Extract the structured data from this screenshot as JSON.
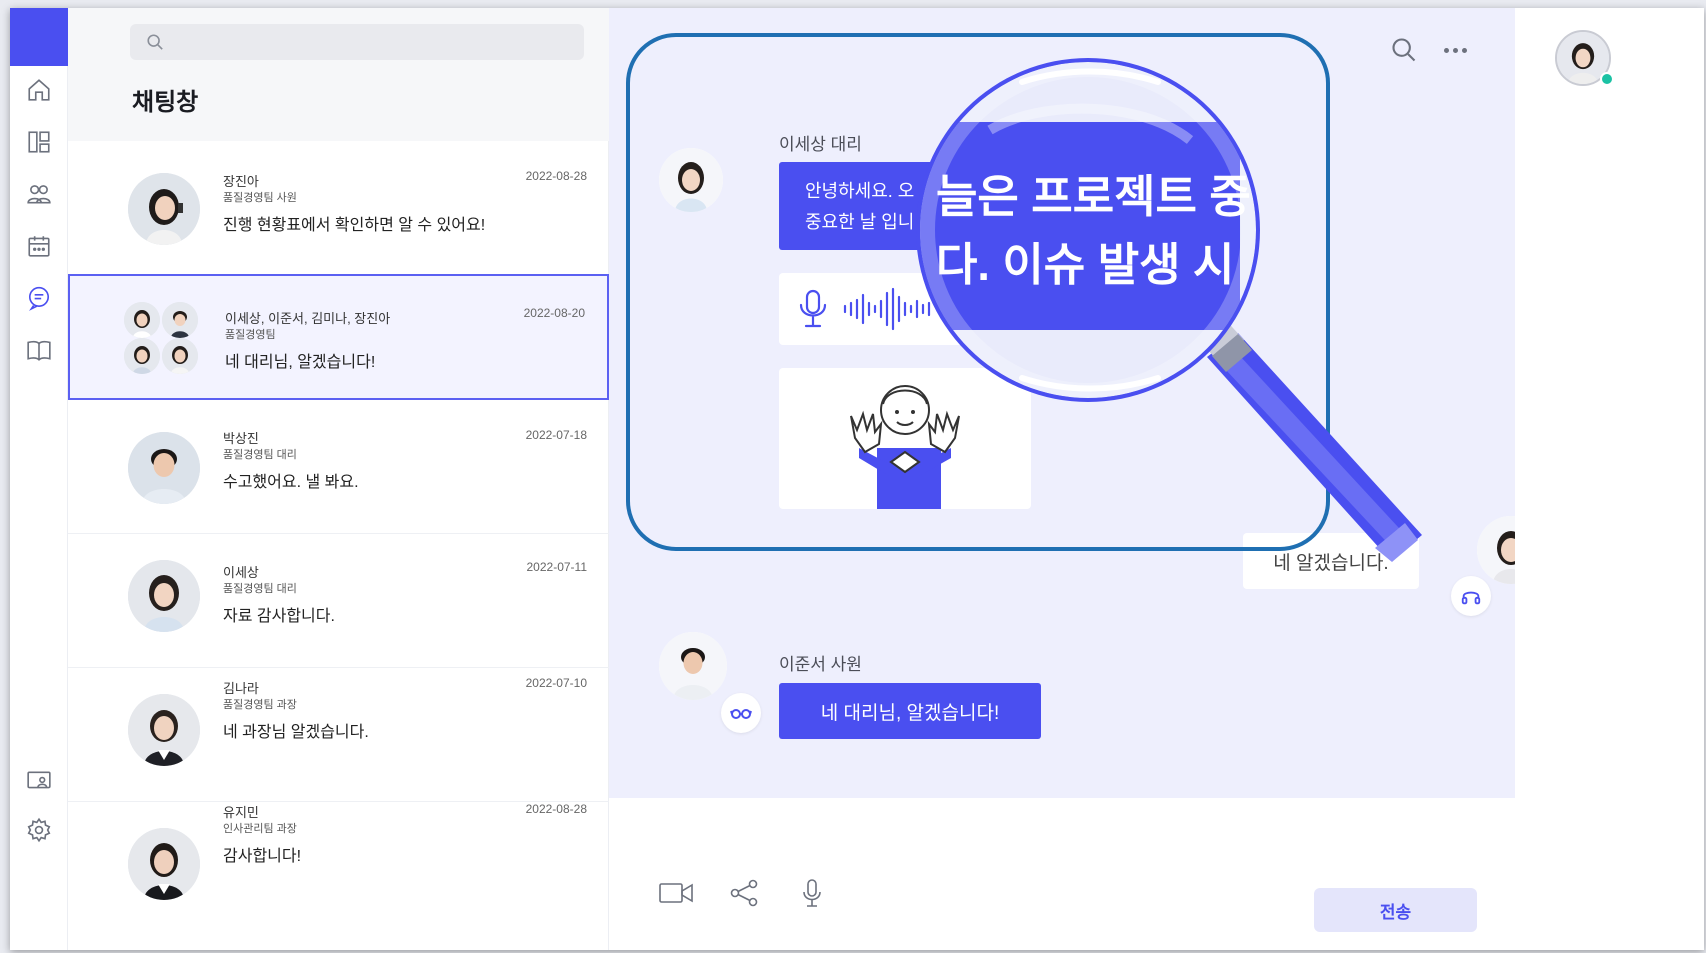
{
  "list": {
    "search_placeholder": "",
    "title": "채팅창",
    "items": [
      {
        "name": "장진아",
        "dept": "품질경영팀 사원",
        "message": "진행 현황표에서 확인하면 알 수 있어요!",
        "date": "2022-08-28"
      },
      {
        "name": "이세상, 이준서, 김미나, 장진아",
        "dept": "품질경영팀",
        "message": "네 대리님, 알겠습니다!",
        "date": "2022-08-20"
      },
      {
        "name": "박상진",
        "dept": "품질경영팀 대리",
        "message": "수고했어요. 낼 봐요.",
        "date": "2022-07-18"
      },
      {
        "name": "이세상",
        "dept": "품질경영팀 대리",
        "message": "자료 감사합니다.",
        "date": "2022-07-11"
      },
      {
        "name": "김나라",
        "dept": "품질경영팀 과장",
        "message": "네 과장님 알겠습니다.",
        "date": "2022-07-10"
      },
      {
        "name": "유지민",
        "dept": "인사관리팀 과장",
        "message": "감사합니다!",
        "date": "2022-08-28"
      }
    ]
  },
  "chat": {
    "msg1": {
      "sender": "이세상 대리",
      "line1": "안녕하세요. 오",
      "line2": "중요한 날 입니"
    },
    "magnified": {
      "line1": "늘은 프로젝트 중",
      "line2": "다. 이슈 발생 시"
    },
    "reply": "네 알겠습니다.",
    "msg2": {
      "sender": "이준서 사원",
      "text": "네 대리님, 알겠습니다!"
    },
    "send_label": "전송"
  },
  "colors": {
    "accent": "#4a4ff0",
    "chat_bg": "#eeeffd",
    "online": "#1bc2a4",
    "highlight_frame": "#1f6fb2"
  },
  "icons": {
    "rail": [
      "home-icon",
      "dashboard-icon",
      "people-icon",
      "calendar-icon",
      "chat-icon",
      "book-icon",
      "screen-share-icon",
      "gear-icon"
    ],
    "chat_top": [
      "search-icon",
      "more-icon"
    ],
    "toolbar": [
      "video-icon",
      "share-icon",
      "microphone-icon"
    ]
  }
}
